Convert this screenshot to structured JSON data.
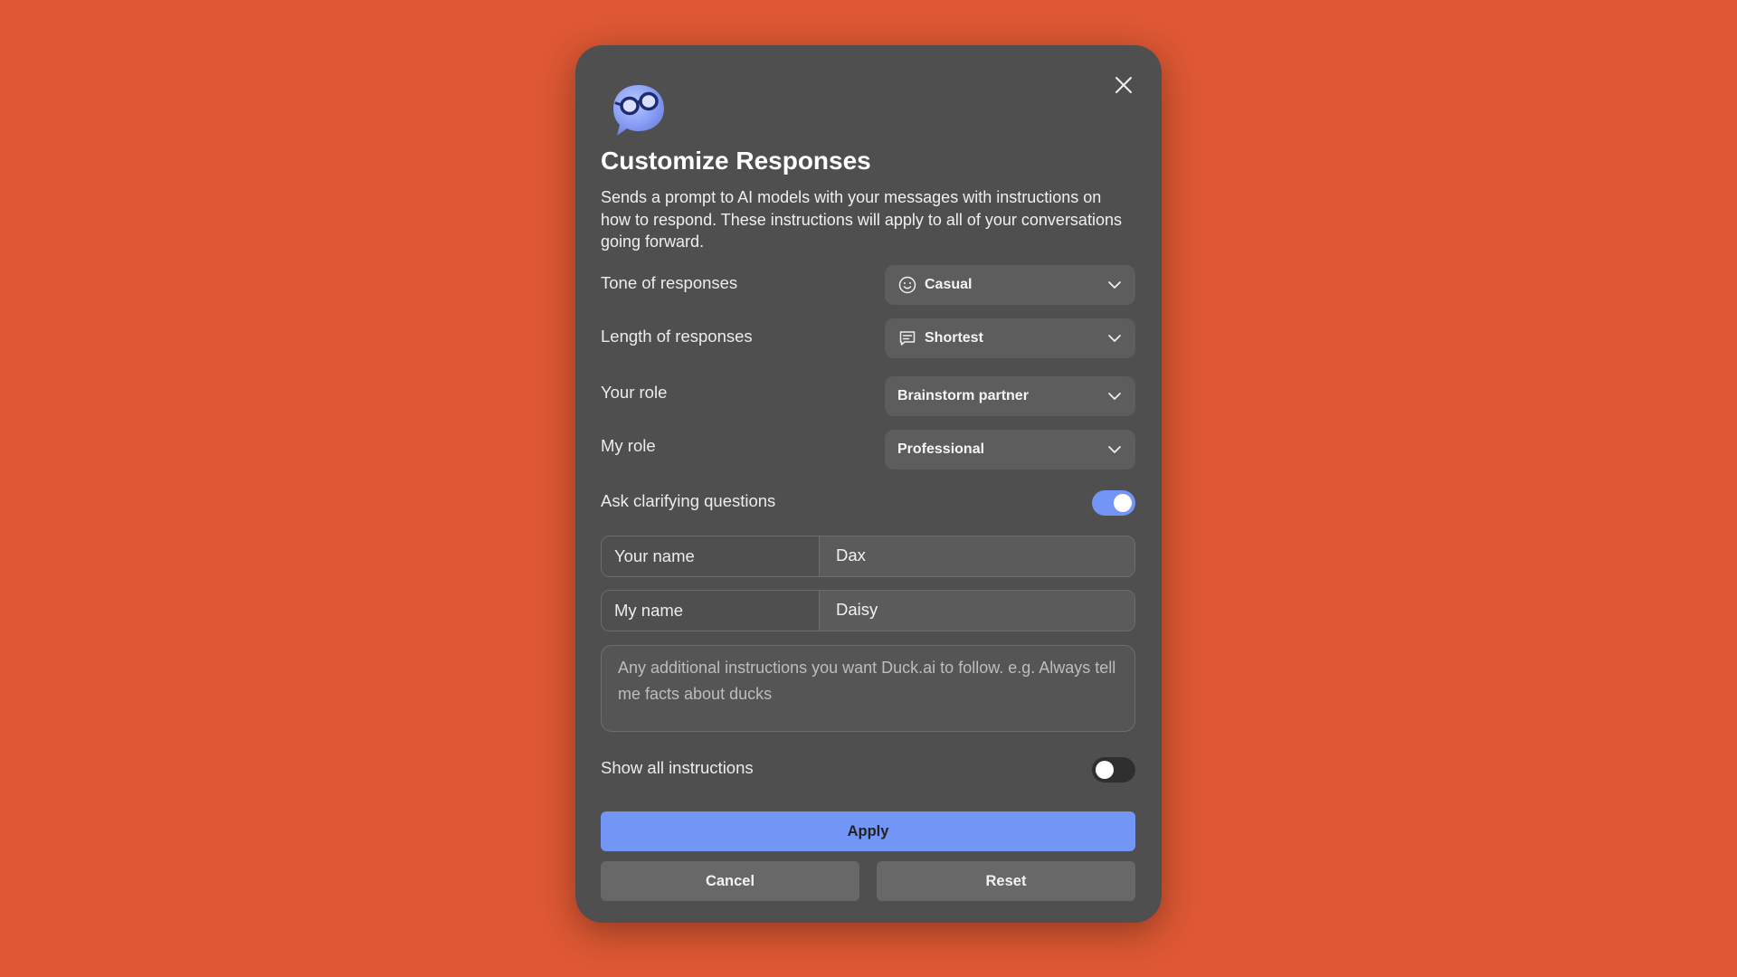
{
  "dialog": {
    "title": "Customize Responses",
    "description": "Sends a prompt to AI models with your messages with instructions on how to respond. These instructions will apply to all of your conversations going forward.",
    "logo_icon": "duck-ai-glasses-logo",
    "close_icon": "close-icon"
  },
  "settings": {
    "tone": {
      "label": "Tone of responses",
      "value": "Casual",
      "icon": "smiley-icon"
    },
    "length": {
      "label": "Length of responses",
      "value": "Shortest",
      "icon": "message-icon"
    },
    "your_role": {
      "label": "Your role",
      "value": "Brainstorm partner"
    },
    "my_role": {
      "label": "My role",
      "value": "Professional"
    },
    "clarifying": {
      "label": "Ask clarifying questions",
      "enabled": true
    },
    "your_name": {
      "label": "Your name",
      "value": "Dax"
    },
    "my_name": {
      "label": "My name",
      "value": "Daisy"
    },
    "instructions": {
      "placeholder": "Any additional instructions you want Duck.ai to follow. e.g. Always tell me facts about ducks",
      "value": ""
    },
    "show_all": {
      "label": "Show all instructions",
      "enabled": false
    }
  },
  "actions": {
    "apply": "Apply",
    "cancel": "Cancel",
    "reset": "Reset"
  },
  "colors": {
    "background": "#DE5833",
    "dialog": "#4F4F4F",
    "accent": "#7295F6"
  }
}
